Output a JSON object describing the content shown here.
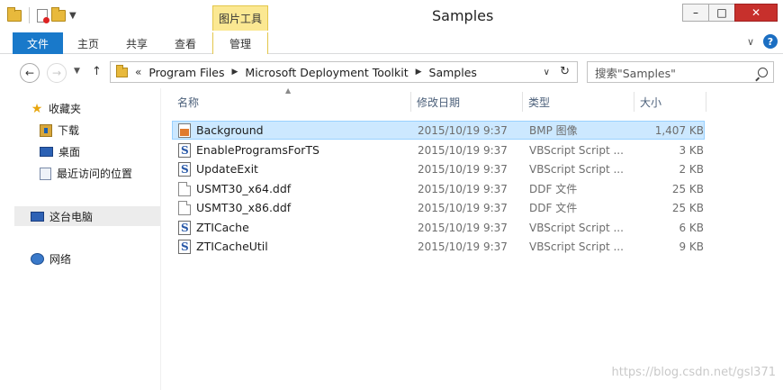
{
  "window": {
    "title": "Samples",
    "context_tab": "图片工具",
    "controls": [
      "–",
      "□",
      "✕"
    ]
  },
  "ribbon": {
    "tabs": [
      "文件",
      "主页",
      "共享",
      "查看",
      "管理"
    ]
  },
  "address": {
    "overflow": "«",
    "crumbs": [
      "Program Files",
      "Microsoft Deployment Toolkit",
      "Samples"
    ],
    "search_placeholder": "搜索\"Samples\""
  },
  "sidebar": {
    "favorites": "收藏夹",
    "fav_items": [
      "下载",
      "桌面",
      "最近访问的位置"
    ],
    "this_pc": "这台电脑",
    "network": "网络"
  },
  "columns": {
    "name": "名称",
    "date": "修改日期",
    "type": "类型",
    "size": "大小"
  },
  "files": [
    {
      "name": "Background",
      "date": "2015/10/19 9:37",
      "type": "BMP 图像",
      "size": "1,407 KB",
      "icon": "bmp-file-icon",
      "selected": true
    },
    {
      "name": "EnableProgramsForTS",
      "date": "2015/10/19 9:37",
      "type": "VBScript Script ...",
      "size": "3 KB",
      "icon": "vbscript-file-icon",
      "selected": false
    },
    {
      "name": "UpdateExit",
      "date": "2015/10/19 9:37",
      "type": "VBScript Script ...",
      "size": "2 KB",
      "icon": "vbscript-file-icon",
      "selected": false
    },
    {
      "name": "USMT30_x64.ddf",
      "date": "2015/10/19 9:37",
      "type": "DDF 文件",
      "size": "25 KB",
      "icon": "ddf-file-icon",
      "selected": false
    },
    {
      "name": "USMT30_x86.ddf",
      "date": "2015/10/19 9:37",
      "type": "DDF 文件",
      "size": "25 KB",
      "icon": "ddf-file-icon",
      "selected": false
    },
    {
      "name": "ZTICache",
      "date": "2015/10/19 9:37",
      "type": "VBScript Script ...",
      "size": "6 KB",
      "icon": "vbscript-file-icon",
      "selected": false
    },
    {
      "name": "ZTICacheUtil",
      "date": "2015/10/19 9:37",
      "type": "VBScript Script ...",
      "size": "9 KB",
      "icon": "vbscript-file-icon",
      "selected": false
    }
  ],
  "watermark": "https://blog.csdn.net/gsl371",
  "colors": {
    "accent": "#1979ca",
    "selection": "#cce8ff",
    "context_tab": "#fbe892",
    "close": "#c7302c"
  }
}
